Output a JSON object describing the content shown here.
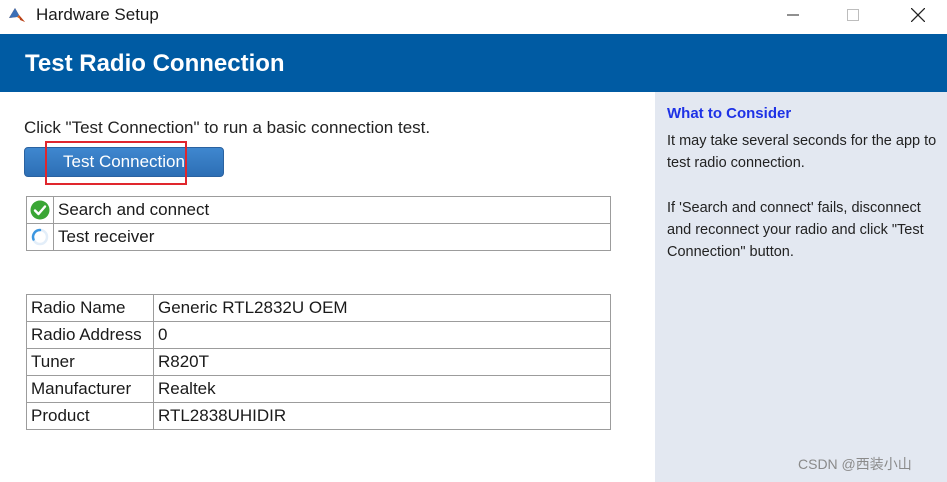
{
  "window": {
    "title": "Hardware Setup"
  },
  "header": {
    "title": "Test Radio Connection"
  },
  "main": {
    "instruction": "Click \"Test Connection\" to run a basic connection test.",
    "test_button_label": "Test Connection",
    "steps": [
      {
        "label": "Search and connect",
        "status": "success",
        "icon": "check-circle-icon"
      },
      {
        "label": "Test receiver",
        "status": "in-progress",
        "icon": "spinner-icon"
      }
    ],
    "properties": [
      {
        "key": "Radio Name",
        "value": "Generic RTL2832U OEM"
      },
      {
        "key": "Radio Address",
        "value": "0"
      },
      {
        "key": "Tuner",
        "value": "R820T"
      },
      {
        "key": "Manufacturer",
        "value": "Realtek"
      },
      {
        "key": "Product",
        "value": "RTL2838UHIDIR"
      }
    ]
  },
  "side_panel": {
    "title": "What to Consider",
    "paragraph1": "It may take several seconds for the app to test radio connection.",
    "paragraph2": "If 'Search and connect' fails, disconnect and reconnect your radio and click \"Test Connection\" button.",
    "watermark": "CSDN @西装小山"
  },
  "colors": {
    "header_bg": "#005ba3",
    "button_bg": "#3a80c8",
    "highlight": "#e0262d",
    "side_bg": "#e3e8f1",
    "side_title": "#1e32e6",
    "success": "#3aa635"
  }
}
